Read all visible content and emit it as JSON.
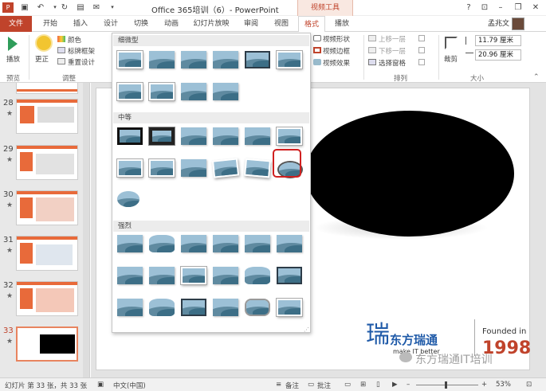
{
  "window": {
    "title": "Office 365培训（6）- PowerPoint",
    "context_group": "视频工具",
    "user": "孟兆文"
  },
  "tabs": [
    "文件",
    "开始",
    "插入",
    "设计",
    "切换",
    "动画",
    "幻灯片放映",
    "审阅",
    "视图",
    "格式",
    "播放"
  ],
  "active_tab": "格式",
  "ribbon": {
    "preview": {
      "play": "播放",
      "group": "预览"
    },
    "adjust": {
      "correct": "更正",
      "color": "颜色",
      "poster": "标牌框架",
      "reset": "重置设计",
      "group": "调整"
    },
    "video_style": {
      "shape": "视频形状",
      "border": "视频边框",
      "effects": "视频效果"
    },
    "arrange": {
      "bring_forward": "上移一层",
      "send_backward": "下移一层",
      "selection_pane": "选择窗格",
      "group": "排列"
    },
    "size": {
      "crop": "裁剪",
      "height": "11.79 厘米",
      "width": "20.96 厘米",
      "group": "大小"
    }
  },
  "gallery": {
    "sections": [
      "细微型",
      "中等",
      "强烈"
    ]
  },
  "slides": [
    {
      "number": "28",
      "star": "★"
    },
    {
      "number": "29",
      "star": "★"
    },
    {
      "number": "30",
      "star": "★"
    },
    {
      "number": "31",
      "star": "★"
    },
    {
      "number": "32",
      "star": "★"
    },
    {
      "number": "33",
      "star": "★"
    }
  ],
  "slide": {
    "brand_cn": "东方瑞通",
    "brand_en": "make IT better",
    "founded": "Founded in",
    "year": "1998",
    "watermark": "东方瑞通IT培训"
  },
  "status": {
    "slide_info": "幻灯片 第 33 张，共 33 张",
    "language": "中文(中国)",
    "notes": "备注",
    "comments": "批注",
    "zoom": "53%"
  },
  "colors": {
    "accent": "#c0432b",
    "highlight": "#d02020"
  }
}
